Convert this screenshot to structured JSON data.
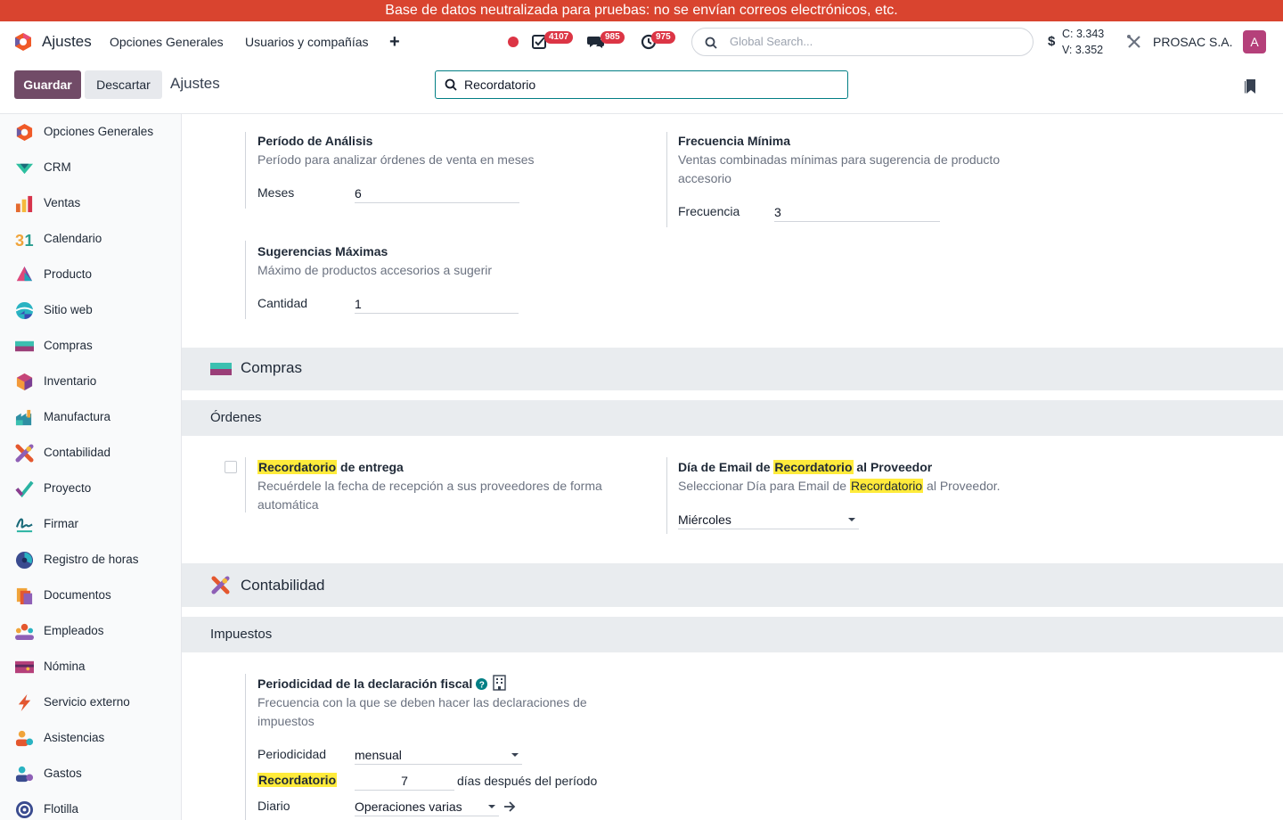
{
  "banner": "Base de datos neutralizada para pruebas: no se envían correos electrónicos, etc.",
  "navbar": {
    "app_name": "Ajustes",
    "menu": [
      "Opciones Generales",
      "Usuarios y compañías"
    ],
    "add_symbol": "+",
    "activity_badge": "4107",
    "messages_badge": "985",
    "clock_badge": "975",
    "search_placeholder": "Global Search...",
    "currency_symbol": "$",
    "rate_c": "C: 3.343",
    "rate_v": "V: 3.352",
    "company": "PROSAC S.A.",
    "avatar_letter": "A",
    "status_color": "#dc3545"
  },
  "controls": {
    "save_label": "Guardar",
    "discard_label": "Descartar",
    "breadcrumb": "Ajustes",
    "search_value": "Recordatorio"
  },
  "sidebar": {
    "items": [
      {
        "label": "Opciones Generales",
        "icon": "settings-app-icon"
      },
      {
        "label": "CRM",
        "icon": "crm-app-icon"
      },
      {
        "label": "Ventas",
        "icon": "sales-app-icon"
      },
      {
        "label": "Calendario",
        "icon": "calendar-app-icon"
      },
      {
        "label": "Producto",
        "icon": "product-app-icon"
      },
      {
        "label": "Sitio web",
        "icon": "website-app-icon"
      },
      {
        "label": "Compras",
        "icon": "purchase-app-icon"
      },
      {
        "label": "Inventario",
        "icon": "inventory-app-icon"
      },
      {
        "label": "Manufactura",
        "icon": "manufacturing-app-icon"
      },
      {
        "label": "Contabilidad",
        "icon": "accounting-app-icon"
      },
      {
        "label": "Proyecto",
        "icon": "project-app-icon"
      },
      {
        "label": "Firmar",
        "icon": "sign-app-icon"
      },
      {
        "label": "Registro de horas",
        "icon": "timesheet-app-icon"
      },
      {
        "label": "Documentos",
        "icon": "documents-app-icon"
      },
      {
        "label": "Empleados",
        "icon": "employees-app-icon"
      },
      {
        "label": "Nómina",
        "icon": "payroll-app-icon"
      },
      {
        "label": "Servicio externo",
        "icon": "field-service-app-icon"
      },
      {
        "label": "Asistencias",
        "icon": "attendances-app-icon"
      },
      {
        "label": "Gastos",
        "icon": "expenses-app-icon"
      },
      {
        "label": "Flotilla",
        "icon": "fleet-app-icon"
      }
    ]
  },
  "sales_block": {
    "analysis_title": "Período de Análisis",
    "analysis_desc": "Período para analizar órdenes de venta en meses",
    "months_label": "Meses",
    "months_value": "6",
    "freq_title": "Frecuencia Mínima",
    "freq_desc_1": "Ventas combinadas mínimas para sugerencia de producto",
    "freq_desc_2": "accesorio",
    "freq_label": "Frecuencia",
    "freq_value": "3",
    "max_title": "Sugerencias Máximas",
    "max_desc": "Máximo de productos accesorios a sugerir",
    "qty_label": "Cantidad",
    "qty_value": "1"
  },
  "purchase": {
    "section_title": "Compras",
    "sub_title": "Órdenes",
    "reminder_highlight": "Recordatorio",
    "reminder_title_rest": " de entrega",
    "reminder_desc_1": "Recuérdele la fecha de recepción a sus proveedores de forma",
    "reminder_desc_2": "automática",
    "email_title_pre": "Día de Email de ",
    "email_title_post": " al Proveedor",
    "email_desc_pre": "Seleccionar Día para Email de ",
    "email_desc_post": " al Proveedor.",
    "email_day_value": "Miércoles"
  },
  "accounting": {
    "section_title": "Contabilidad",
    "sub_title": "Impuestos",
    "periodicity_title": "Periodicidad de la declaración fiscal",
    "periodicity_desc_1": "Frecuencia con la que se deben hacer las declaraciones de",
    "periodicity_desc_2": "impuestos",
    "periodicity_label": "Periodicidad",
    "periodicity_value": "mensual",
    "reminder_label": "Recordatorio",
    "reminder_value": "7",
    "reminder_suffix": "días después del período",
    "journal_label": "Diario",
    "journal_value": "Operaciones varias"
  }
}
